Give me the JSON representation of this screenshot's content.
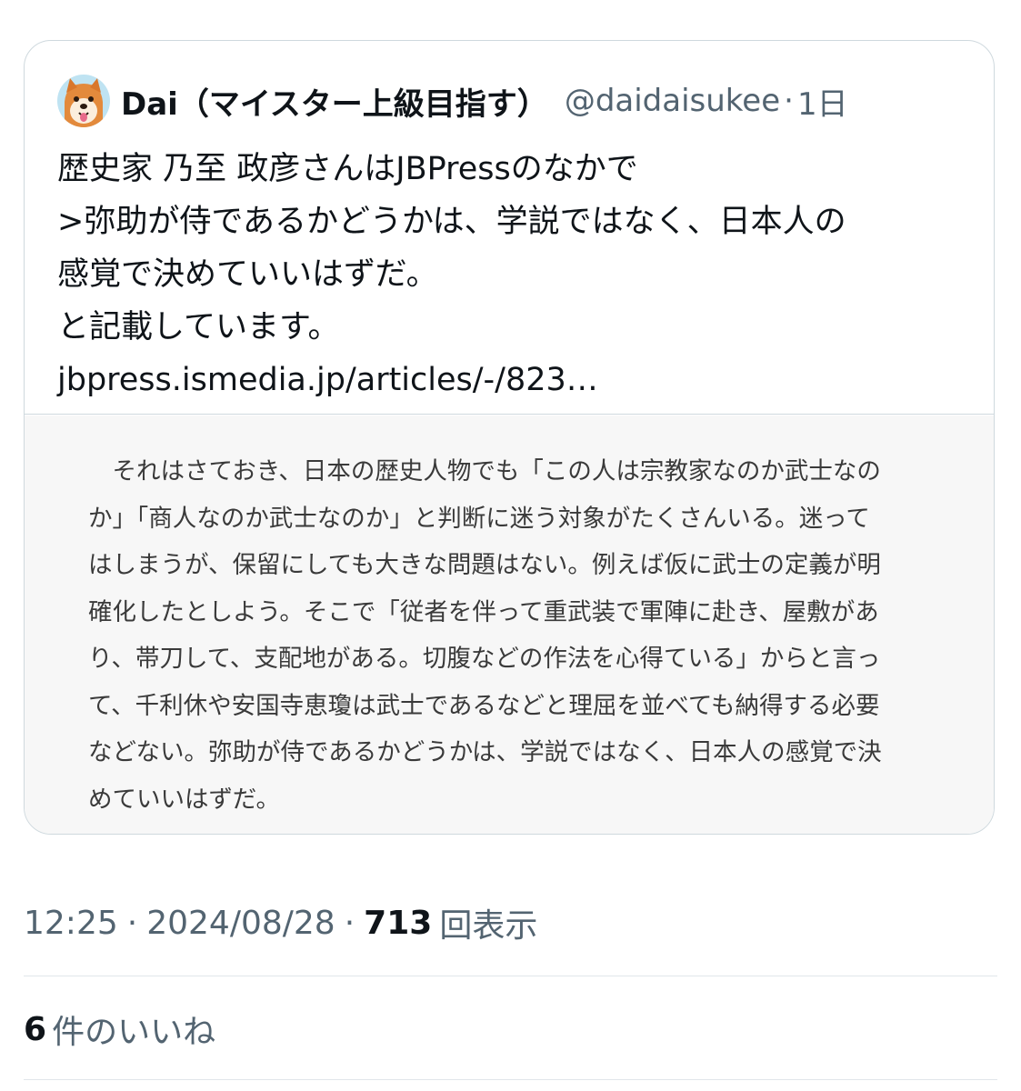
{
  "quoted_tweet": {
    "author": {
      "display_name": "Dai（マイスター上級目指す）",
      "handle": "@daidaisukee",
      "avatar": "shiba-inu-avatar"
    },
    "separator": "·",
    "age": "1日",
    "text_lines": [
      "歴史家 乃至 政彦さんはJBPressのなかで",
      ">弥助が侍であるかどうかは、学説ではなく、日本人の",
      "感覚で決めていいはずだ。",
      "と記載しています。",
      "jbpress.ismedia.jp/articles/-/823…"
    ],
    "article_excerpt_lines": [
      "　それはさておき、日本の歴史人物でも「この人は宗教家なのか武士なの",
      "か」「商人なのか武士なのか」と判断に迷う対象がたくさんいる。迷って",
      "はしまうが、保留にしても大きな問題はない。例えば仮に武士の定義が明",
      "確化したとしよう。そこで「従者を伴って重武装で軍陣に赴き、屋敷があ",
      "り、帯刀して、支配地がある。切腹などの作法を心得ている」からと言っ",
      "て、千利休や安国寺恵瓊は武士であるなどと理屈を並べても納得する必要",
      "などない。弥助が侍であるかどうかは、学説ではなく、日本人の感覚で決",
      "めていいはずだ。"
    ]
  },
  "meta": {
    "time": "12:25",
    "sep1": "·",
    "date": "2024/08/28",
    "sep2": "·",
    "views_count": "713",
    "views_label": "回表示"
  },
  "likes": {
    "count": "6",
    "label": "件のいいね"
  }
}
